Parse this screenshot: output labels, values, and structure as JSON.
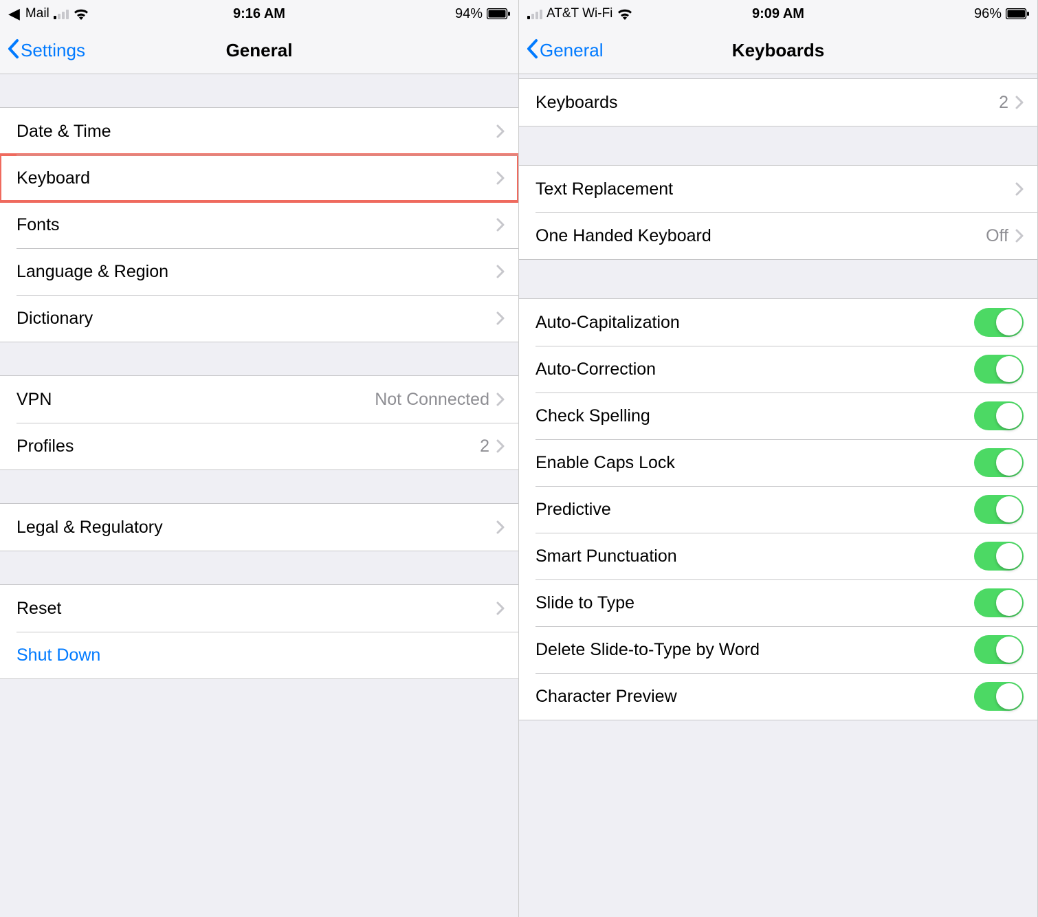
{
  "left": {
    "status": {
      "back_app": "Mail",
      "signal_active": 1,
      "time": "9:16 AM",
      "battery_pct": "94%"
    },
    "nav": {
      "back": "Settings",
      "title": "General"
    },
    "sections": [
      {
        "rows": [
          {
            "name": "date-time",
            "label": "Date & Time",
            "chevron": true
          },
          {
            "name": "keyboard",
            "label": "Keyboard",
            "chevron": true,
            "highlight": true
          },
          {
            "name": "fonts",
            "label": "Fonts",
            "chevron": true
          },
          {
            "name": "language-region",
            "label": "Language & Region",
            "chevron": true
          },
          {
            "name": "dictionary",
            "label": "Dictionary",
            "chevron": true
          }
        ]
      },
      {
        "rows": [
          {
            "name": "vpn",
            "label": "VPN",
            "value": "Not Connected",
            "chevron": true
          },
          {
            "name": "profiles",
            "label": "Profiles",
            "value": "2",
            "chevron": true
          }
        ]
      },
      {
        "rows": [
          {
            "name": "legal",
            "label": "Legal & Regulatory",
            "chevron": true
          }
        ]
      },
      {
        "rows": [
          {
            "name": "reset",
            "label": "Reset",
            "chevron": true
          },
          {
            "name": "shut-down",
            "label": "Shut Down",
            "blue": true
          }
        ]
      }
    ]
  },
  "right": {
    "status": {
      "carrier": "AT&T Wi-Fi",
      "signal_active": 1,
      "time": "9:09 AM",
      "battery_pct": "96%"
    },
    "nav": {
      "back": "General",
      "title": "Keyboards"
    },
    "sections": [
      {
        "rows": [
          {
            "name": "keyboards",
            "label": "Keyboards",
            "value": "2",
            "chevron": true
          }
        ]
      },
      {
        "rows": [
          {
            "name": "text-replacement",
            "label": "Text Replacement",
            "chevron": true
          },
          {
            "name": "one-handed",
            "label": "One Handed Keyboard",
            "value": "Off",
            "chevron": true
          }
        ]
      },
      {
        "rows": [
          {
            "name": "auto-cap",
            "label": "Auto-Capitalization",
            "toggle": true,
            "on": true
          },
          {
            "name": "auto-correct",
            "label": "Auto-Correction",
            "toggle": true,
            "on": true
          },
          {
            "name": "check-spelling",
            "label": "Check Spelling",
            "toggle": true,
            "on": true
          },
          {
            "name": "caps-lock",
            "label": "Enable Caps Lock",
            "toggle": true,
            "on": true
          },
          {
            "name": "predictive",
            "label": "Predictive",
            "toggle": true,
            "on": true
          },
          {
            "name": "smart-punct",
            "label": "Smart Punctuation",
            "toggle": true,
            "on": true
          },
          {
            "name": "slide-to-type",
            "label": "Slide to Type",
            "toggle": true,
            "on": true
          },
          {
            "name": "delete-slide",
            "label": "Delete Slide-to-Type by Word",
            "toggle": true,
            "on": true
          },
          {
            "name": "char-preview",
            "label": "Character Preview",
            "toggle": true,
            "on": true
          }
        ]
      }
    ]
  }
}
